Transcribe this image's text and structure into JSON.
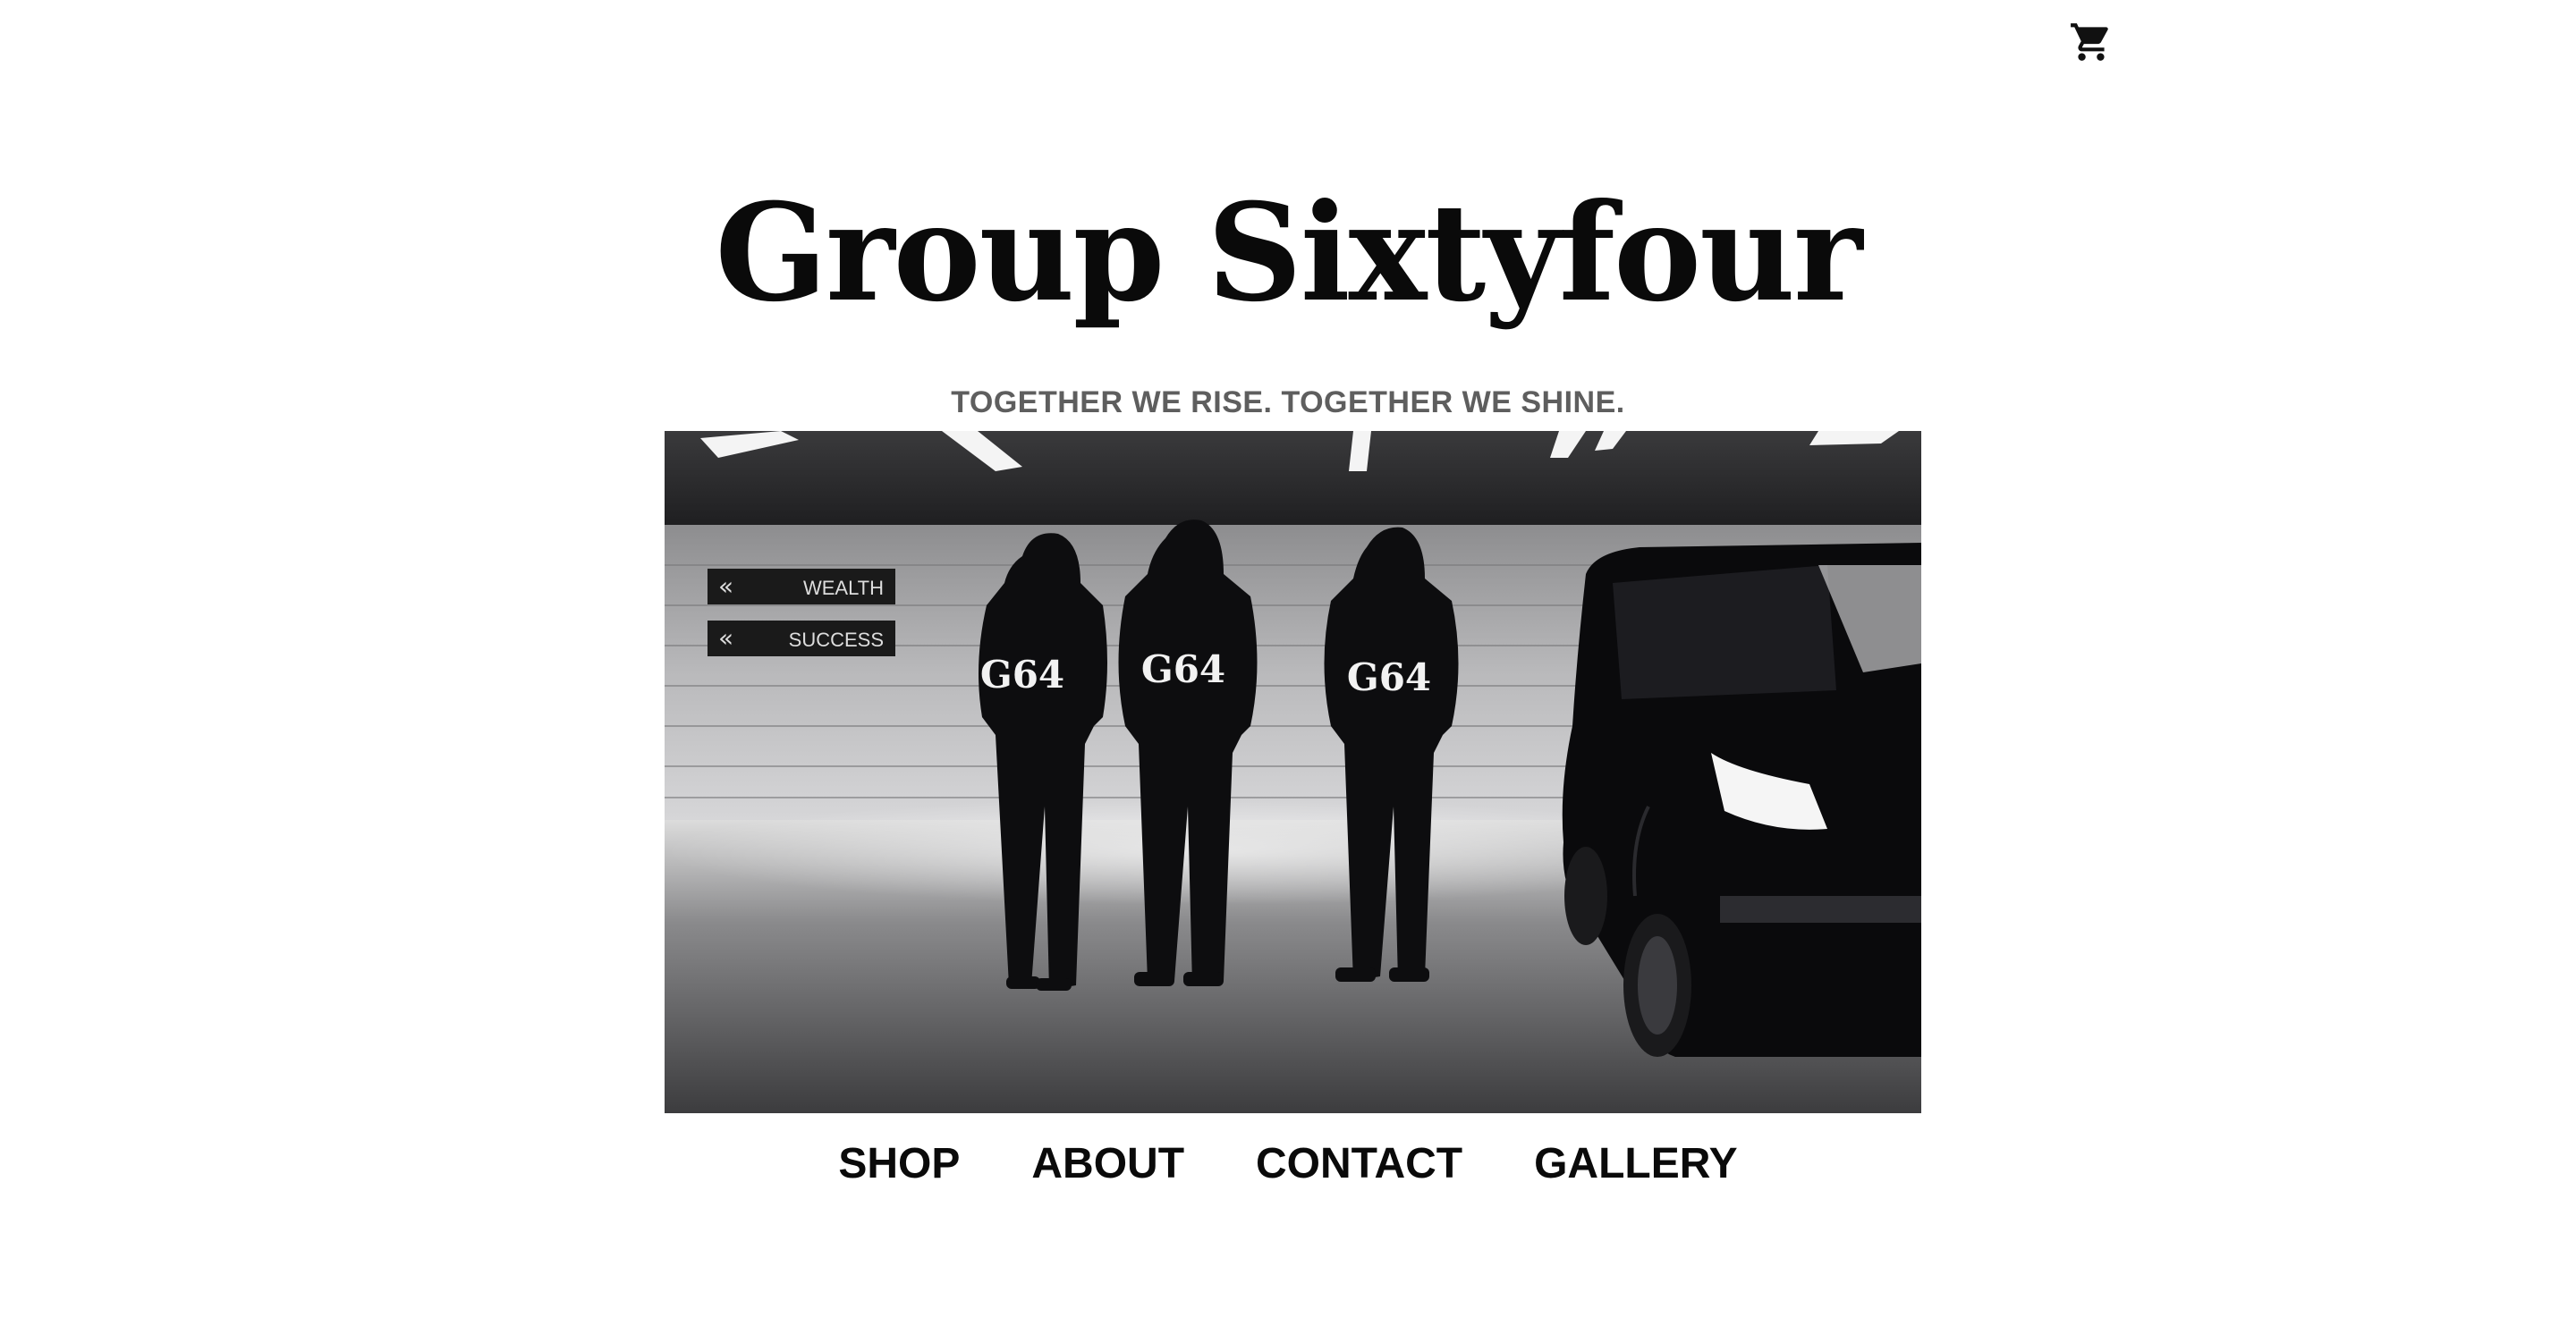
{
  "header": {
    "cart_icon": "cart-icon"
  },
  "brand": {
    "title": "Group Sixtyfour",
    "tagline": "TOGETHER WE RISE. TOGETHER WE SHINE."
  },
  "hero": {
    "signs": [
      "WEALTH",
      "SUCCESS"
    ],
    "hoodie_text": "G64"
  },
  "nav": {
    "items": [
      {
        "label": "SHOP"
      },
      {
        "label": "ABOUT"
      },
      {
        "label": "CONTACT"
      },
      {
        "label": "GALLERY"
      }
    ]
  },
  "colors": {
    "text": "#0a0a0a",
    "tagline": "#5e5e5e",
    "background": "#ffffff"
  }
}
